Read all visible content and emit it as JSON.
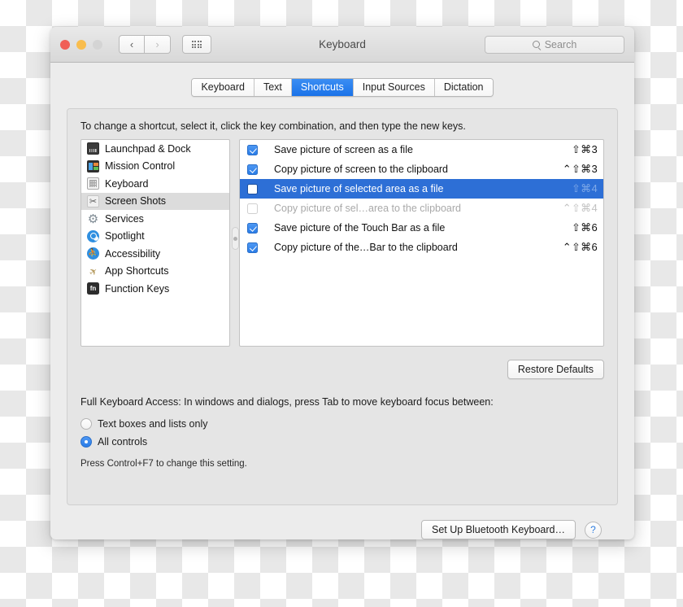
{
  "window": {
    "title": "Keyboard",
    "traffic_lights": [
      "close",
      "minimize",
      "zoom"
    ],
    "nav_back": "‹",
    "nav_forward": "›",
    "grid_button": "show-all-icon",
    "search_placeholder": "Search"
  },
  "tabs": [
    {
      "label": "Keyboard",
      "active": false
    },
    {
      "label": "Text",
      "active": false
    },
    {
      "label": "Shortcuts",
      "active": true
    },
    {
      "label": "Input Sources",
      "active": false
    },
    {
      "label": "Dictation",
      "active": false
    }
  ],
  "panel": {
    "hint": "To change a shortcut, select it, click the key combination, and then type the new keys.",
    "restore_defaults_label": "Restore Defaults"
  },
  "categories": [
    {
      "label": "Launchpad & Dock",
      "icon": "launchpad-icon",
      "selected": false
    },
    {
      "label": "Mission Control",
      "icon": "mission-control-icon",
      "selected": false
    },
    {
      "label": "Keyboard",
      "icon": "keyboard-icon",
      "selected": false
    },
    {
      "label": "Screen Shots",
      "icon": "screenshots-icon",
      "selected": true
    },
    {
      "label": "Services",
      "icon": "services-gear-icon",
      "selected": false
    },
    {
      "label": "Spotlight",
      "icon": "spotlight-search-icon",
      "selected": false
    },
    {
      "label": "Accessibility",
      "icon": "accessibility-icon",
      "selected": false
    },
    {
      "label": "App Shortcuts",
      "icon": "app-shortcuts-icon",
      "selected": false
    },
    {
      "label": "Function Keys",
      "icon": "function-keys-fn-icon",
      "selected": false
    }
  ],
  "shortcuts": [
    {
      "label": "Save picture of screen as a file",
      "combo": "⇧⌘3",
      "checked": true,
      "selected": false,
      "enabled": true
    },
    {
      "label": "Copy picture of screen to the clipboard",
      "combo": "⌃⇧⌘3",
      "checked": true,
      "selected": false,
      "enabled": true
    },
    {
      "label": "Save picture of selected area as a file",
      "combo": "⇧⌘4",
      "checked": false,
      "selected": true,
      "enabled": true
    },
    {
      "label": "Copy picture of sel…area to the clipboard",
      "combo": "⌃⇧⌘4",
      "checked": false,
      "selected": false,
      "enabled": false
    },
    {
      "label": "Save picture of the Touch Bar as a file",
      "combo": "⇧⌘6",
      "checked": true,
      "selected": false,
      "enabled": true
    },
    {
      "label": "Copy picture of the…Bar to the clipboard",
      "combo": "⌃⇧⌘6",
      "checked": true,
      "selected": false,
      "enabled": true
    }
  ],
  "full_keyboard_access": {
    "description": "Full Keyboard Access: In windows and dialogs, press Tab to move keyboard focus between:",
    "options": [
      {
        "label": "Text boxes and lists only",
        "selected": false
      },
      {
        "label": "All controls",
        "selected": true
      }
    ],
    "note": "Press Control+F7 to change this setting."
  },
  "footer": {
    "bluetooth_button_label": "Set Up Bluetooth Keyboard…",
    "help_label": "?"
  },
  "colors": {
    "accent_blue": "#2a7de8",
    "selection_blue": "#2d6fd6",
    "tab_active": "#1a72e8",
    "window_bg": "#ececec",
    "panel_bg": "#e5e5e5"
  }
}
